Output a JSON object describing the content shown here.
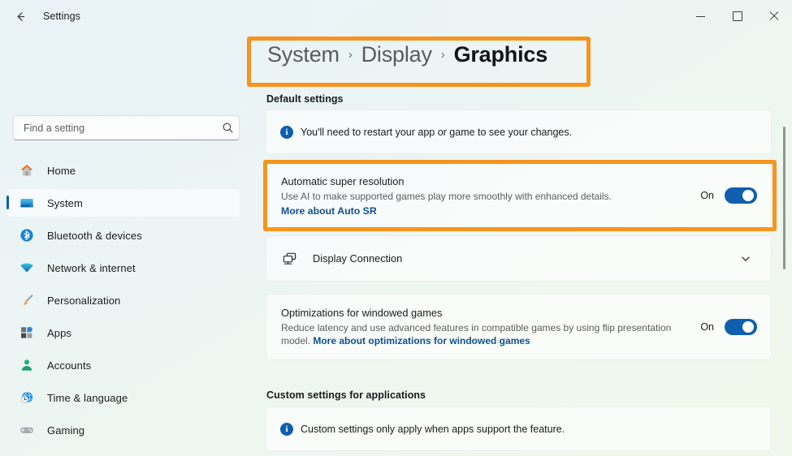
{
  "window": {
    "app_title": "Settings",
    "back_icon": "back-arrow-icon",
    "controls": {
      "minimize": "Minimize",
      "maximize": "Maximize",
      "close": "Close"
    }
  },
  "search": {
    "placeholder": "Find a setting",
    "value": "",
    "icon": "search-icon"
  },
  "sidebar": {
    "items": [
      {
        "label": "Home",
        "icon": "home-icon",
        "selected": false
      },
      {
        "label": "System",
        "icon": "system-monitor-icon",
        "selected": true
      },
      {
        "label": "Bluetooth & devices",
        "icon": "bluetooth-icon",
        "selected": false
      },
      {
        "label": "Network & internet",
        "icon": "wifi-icon",
        "selected": false
      },
      {
        "label": "Personalization",
        "icon": "paintbrush-icon",
        "selected": false
      },
      {
        "label": "Apps",
        "icon": "apps-grid-icon",
        "selected": false
      },
      {
        "label": "Accounts",
        "icon": "person-icon",
        "selected": false
      },
      {
        "label": "Time & language",
        "icon": "clock-globe-icon",
        "selected": false
      },
      {
        "label": "Gaming",
        "icon": "gamepad-icon",
        "selected": false
      }
    ]
  },
  "breadcrumb": {
    "segments": [
      "System",
      "Display",
      "Graphics"
    ],
    "separator": "›",
    "current_index": 2
  },
  "content": {
    "default_settings_heading": "Default settings",
    "restart_notice": {
      "icon": "info-icon",
      "text": "You'll need to restart your app or game to see your changes."
    },
    "auto_super_resolution": {
      "title": "Automatic super resolution",
      "description": "Use AI to make supported games play more smoothly with enhanced details.",
      "link": "More about Auto SR",
      "toggle_state": "On",
      "toggle_on": true
    },
    "display_connection": {
      "label": "Display Connection",
      "icon": "dual-display-icon",
      "chevron": "chevron-down-icon",
      "expanded": false
    },
    "windowed_optimizations": {
      "title": "Optimizations for windowed games",
      "description": "Reduce latency and use advanced features in compatible games by using flip presentation model. ",
      "link": "More about optimizations for windowed games",
      "toggle_state": "On",
      "toggle_on": true
    },
    "custom_settings_heading": "Custom settings for applications",
    "custom_notice": {
      "icon": "info-icon",
      "text": "Custom settings only apply when apps support the feature."
    }
  },
  "annotations": {
    "highlight_color": "#f7941d",
    "boxes": [
      "breadcrumb-highlight",
      "auto-super-resolution-highlight"
    ]
  },
  "theme": {
    "accent": "#0f5fb0",
    "link": "#10508f",
    "highlight": "#f7941d",
    "text_primary": "#1b1b1b",
    "text_secondary": "#5c5c5c"
  }
}
